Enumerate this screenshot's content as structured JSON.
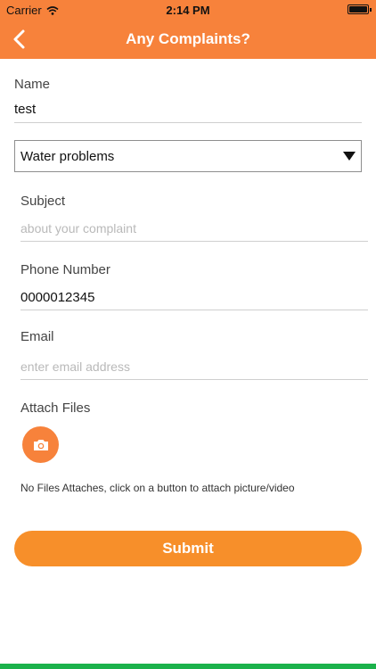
{
  "status_bar": {
    "carrier": "Carrier",
    "time": "2:14 PM",
    "battery_level": 1.0
  },
  "nav": {
    "title": "Any Complaints?",
    "back_icon": "chevron-left-icon"
  },
  "form": {
    "name_label": "Name",
    "name_value": "test",
    "category_value": "Water problems",
    "subject_label": "Subject",
    "subject_placeholder": "about your complaint",
    "phone_label": "Phone Number",
    "phone_value": "0000012345",
    "email_label": "Email",
    "email_placeholder": "enter email address",
    "attach_label": "Attach Files",
    "attach_icon": "camera-icon",
    "attach_note": "No Files Attaches, click on a button to attach picture/video",
    "submit_label": "Submit"
  },
  "colors": {
    "accent": "#f7823b",
    "submit": "#f78f2a",
    "bottom_bar": "#1bb24b"
  }
}
